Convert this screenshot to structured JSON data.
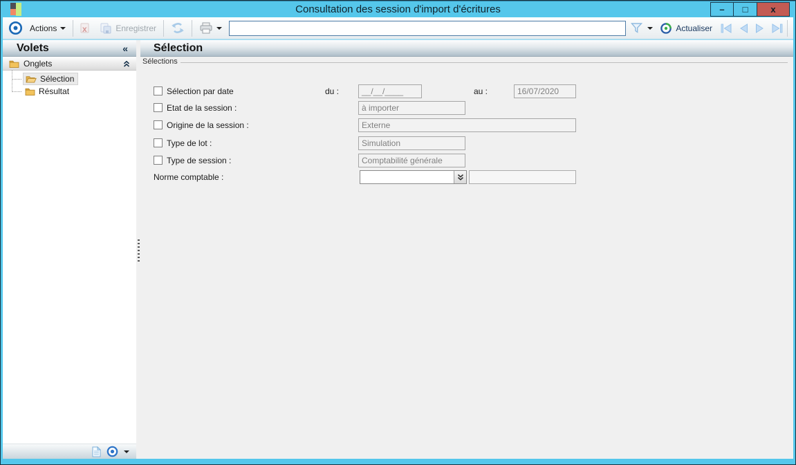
{
  "window": {
    "title": "Consultation des session d'import d'écritures",
    "minimize_glyph": "–",
    "maximize_glyph": "□",
    "close_glyph": "x"
  },
  "toolbar": {
    "actions_label": "Actions",
    "enregistrer_label": "Enregistrer",
    "search_value": "",
    "actualiser_label": "Actualiser"
  },
  "sidebar": {
    "title": "Volets",
    "collapse_glyph": "«",
    "group_label": "Onglets",
    "items": [
      {
        "label": "Sélection",
        "selected": true
      },
      {
        "label": "Résultat",
        "selected": false
      }
    ]
  },
  "main": {
    "title": "Sélection",
    "group_label": "Sélections",
    "rows": [
      {
        "checked": false,
        "label": "Sélection par date",
        "du_label": "du :",
        "du_value": "__/__/____",
        "au_label": "au :",
        "au_value": "16/07/2020"
      },
      {
        "checked": false,
        "label": "Etat de la session :",
        "value": "à importer"
      },
      {
        "checked": false,
        "label": "Origine de la session :",
        "value": "Externe"
      },
      {
        "checked": false,
        "label": "Type de lot :",
        "value": "Simulation"
      },
      {
        "checked": false,
        "label": "Type de session :",
        "value": "Comptabilité générale"
      },
      {
        "label": "Norme comptable :",
        "combo_value": "",
        "extra_value": ""
      }
    ]
  },
  "icons": {
    "app": "four-color-squares",
    "actions": "blue-target-circle",
    "delete": "document-with-red-x",
    "save": "blue-documents",
    "refresh": "blue-sync-arrows",
    "print": "printer",
    "filter": "funnel",
    "actualiser": "green-blue-refresh-circle",
    "nav": [
      "first",
      "previous",
      "next",
      "last"
    ],
    "tree": "gold-folders",
    "bottom": [
      "document",
      "blue-target-circle",
      "caret-down"
    ]
  },
  "colors": {
    "titlebar": "#55C7EB",
    "close_button": "#C35B53",
    "header_gradient_bottom": "#AEBEC9",
    "accent_blue": "#1B69B6",
    "folder_gold": "#F2C35C",
    "disabled_text": "#808080",
    "page_background": "#F0F0F0"
  }
}
